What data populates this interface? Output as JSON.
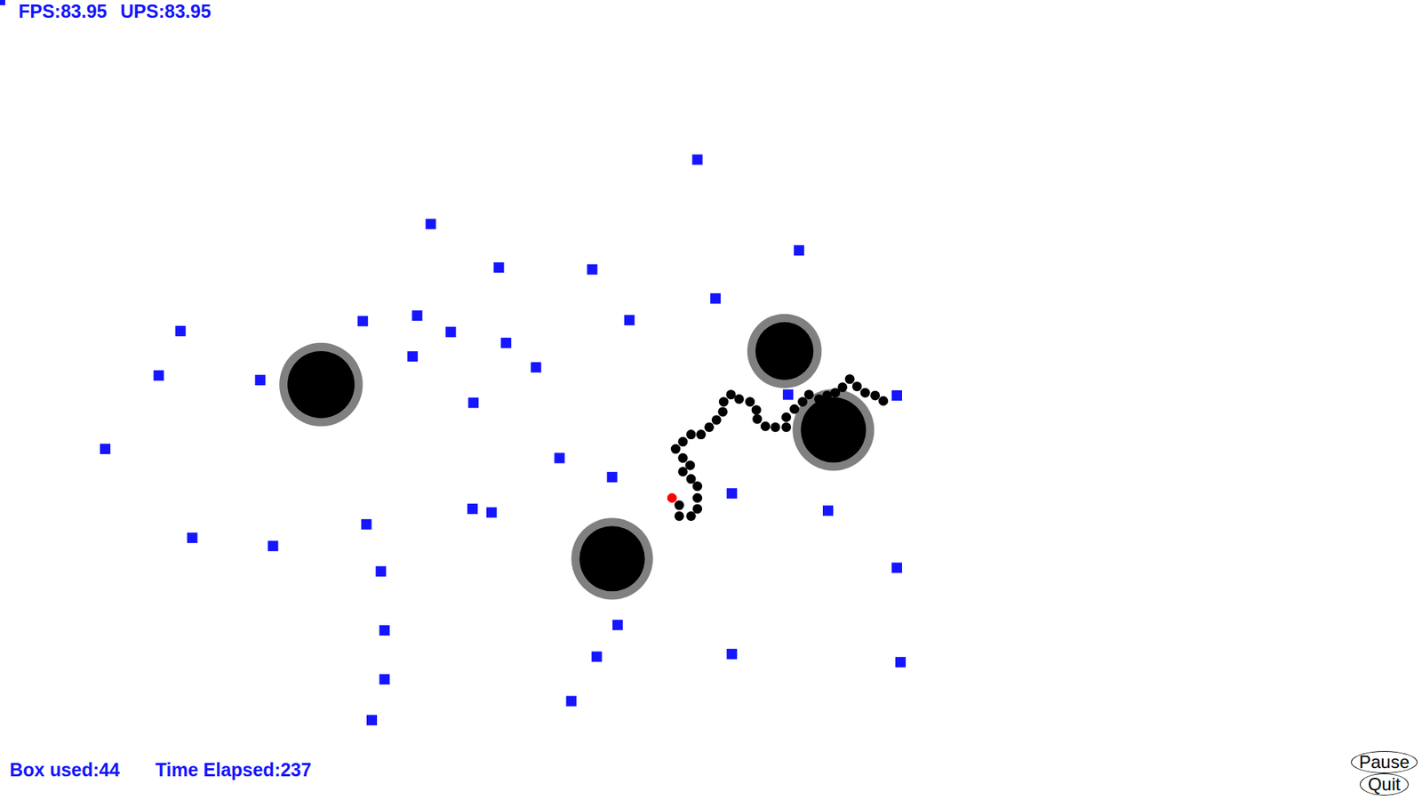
{
  "hud": {
    "fps": "FPS:83.95",
    "ups": "UPS:83.95"
  },
  "status": {
    "box_used": "Box used:44",
    "time_elapsed": "Time Elapsed:237"
  },
  "snake": {
    "head": {
      "color": "#ff0000"
    },
    "body": {
      "color": "#000000"
    }
  },
  "buttons": [
    {
      "label": "Pause"
    },
    {
      "label": "Quit"
    }
  ]
}
